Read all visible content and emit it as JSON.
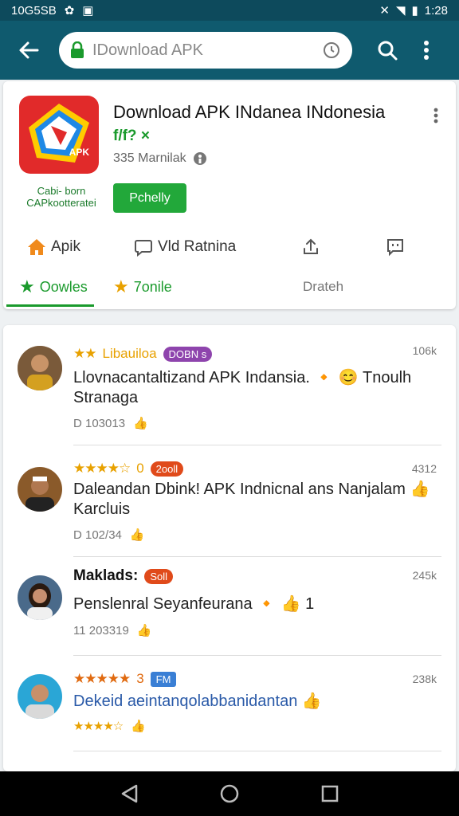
{
  "status_bar": {
    "time_left": "10G5SB",
    "time_right": "1:28"
  },
  "search": {
    "placeholder": "IDownload APK"
  },
  "app": {
    "title": "Download APK INdanea INdonesia",
    "tag": "f/f? ×",
    "meta": "335 Marnilak",
    "icon_label": "APK",
    "developer_line1": "Cabi- born",
    "developer_line2": "CAPkootteratei",
    "install_label": "Pchelly"
  },
  "tabs": {
    "row1": [
      {
        "label": "Apik",
        "icon": "home-icon"
      },
      {
        "label": "Vld Ratnina",
        "icon": "chat-icon"
      },
      {
        "label": "",
        "icon": "share-icon"
      },
      {
        "label": "",
        "icon": "report-icon"
      }
    ],
    "row2": [
      {
        "label": "Oowles",
        "icon": "star-icon"
      },
      {
        "label": "7onile",
        "icon": "star-icon"
      },
      {
        "label": "Drateh",
        "icon": ""
      }
    ]
  },
  "reviews": [
    {
      "header": "Libauiloa",
      "stars": "★★",
      "badge": "DOBN s",
      "badge_color": "#8e44ad",
      "count": "106k",
      "body": "Llovnacantaltizand APK Indansia. 🔸 😊 Tnoulh Stranaga",
      "footer": "D 103013"
    },
    {
      "header": "0",
      "stars": "★★★★☆",
      "badge": "2ooll",
      "badge_color": "#e04a1a",
      "count": "4312",
      "body": "Daleandan Dbink! APK Indnicnal ans Nanjalam 👍 Karcluis",
      "footer": "D 102/34"
    },
    {
      "header": "Maklads:",
      "stars": "",
      "badge": "Soll",
      "badge_color": "#e04a1a",
      "count": "245k",
      "body": "Penslenral Seyanfeurana 🔸 👍 1",
      "footer": "11 203319"
    },
    {
      "header": "3",
      "stars": "★★★★★",
      "badge": "FM",
      "badge_color": "#3a7fd5",
      "count": "238k",
      "body": "Dekeid aeintanqolabbanidantan 👍",
      "footer": "★★★★☆"
    }
  ],
  "colors": {
    "green": "#22a83a",
    "teal": "#0f5a6e",
    "star": "#e8a100"
  }
}
